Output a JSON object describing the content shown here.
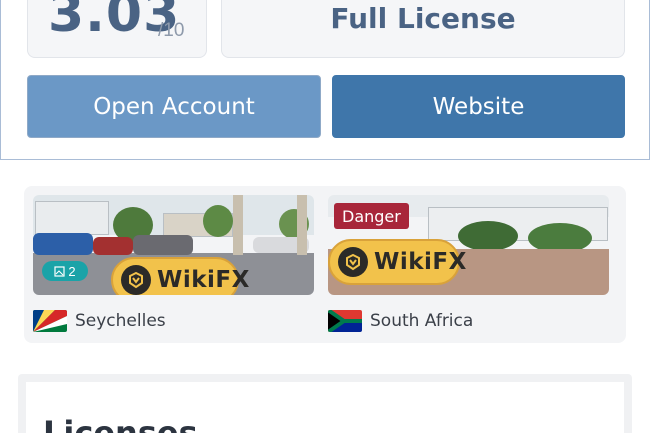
{
  "header": {
    "score": "3.03",
    "score_scale": "/10",
    "license_label": "Full License"
  },
  "actions": {
    "open_account_label": "Open Account",
    "website_label": "Website"
  },
  "gallery": {
    "items": [
      {
        "badge_count": "2",
        "brand_text": "WikiFX",
        "country": "Seychelles",
        "flag_icon": "seychelles-flag"
      },
      {
        "tag": "Danger",
        "brand_text": "WikiFX",
        "country": "South Africa",
        "flag_icon": "south-africa-flag"
      }
    ]
  },
  "licenses": {
    "title": "Licenses"
  },
  "colors": {
    "primary_blue": "#3f76aa",
    "light_blue": "#6b98c6",
    "score_text": "#4a6384",
    "danger": "#a8263a",
    "badge_teal": "#1aa3a8",
    "wikifx_yellow": "#f2c24b"
  }
}
